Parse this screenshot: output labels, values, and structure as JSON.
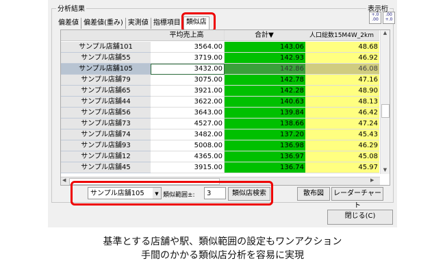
{
  "group_title": "分析結果",
  "digits_label": "表示桁",
  "digits_buttons": [
    ".0\n.00",
    ".00\n.0"
  ],
  "tabs": [
    "偏差値",
    "偏差値(重み)",
    "実測値",
    "指標項目",
    "類似店"
  ],
  "active_tab": "類似店",
  "columns": [
    "",
    "平均売上高",
    "合計▼",
    "人口総数15M4W_2km"
  ],
  "rows": [
    {
      "name": "サンプル店舗101",
      "sales": "3564.00",
      "total": "143.06",
      "pop": "48.68"
    },
    {
      "name": "サンプル店舗55",
      "sales": "3719.00",
      "total": "142.93",
      "pop": "46.92"
    },
    {
      "name": "サンプル店舗105",
      "sales": "3432.00",
      "total": "142.86",
      "pop": "46.08",
      "selected": true
    },
    {
      "name": "サンプル店舗79",
      "sales": "3075.00",
      "total": "142.78",
      "pop": "47.16"
    },
    {
      "name": "サンプル店舗65",
      "sales": "3921.00",
      "total": "142.28",
      "pop": "48.90"
    },
    {
      "name": "サンプル店舗44",
      "sales": "3622.00",
      "total": "140.63",
      "pop": "48.13"
    },
    {
      "name": "サンプル店舗56",
      "sales": "3643.00",
      "total": "139.84",
      "pop": "46.42"
    },
    {
      "name": "サンプル店舗73",
      "sales": "4527.00",
      "total": "138.66",
      "pop": "47.24"
    },
    {
      "name": "サンプル店舗74",
      "sales": "3482.00",
      "total": "137.20",
      "pop": "45.43"
    },
    {
      "name": "サンプル店舗93",
      "sales": "5008.00",
      "total": "136.98",
      "pop": "46.29"
    },
    {
      "name": "サンプル店舗12",
      "sales": "4365.00",
      "total": "136.97",
      "pop": "45.08"
    },
    {
      "name": "サンプル店舗45",
      "sales": "3915.00",
      "total": "136.74",
      "pop": "45.97"
    }
  ],
  "colors": {
    "total": "#00c000",
    "pop": "#ffff80",
    "highlight": "#e00000"
  },
  "controls": {
    "store_select": "サンプル店舗105",
    "range_label": "類似範囲±:",
    "range_value": "3",
    "search_button": "類似店検索",
    "scatter_button": "散布図",
    "radar_button": "レーダーチャート",
    "close_button": "閉じる(C)"
  },
  "caption": [
    "基準とする店舗や駅、類似範囲の設定もワンアクション",
    "手間のかかる類似店分析を容易に実現"
  ]
}
